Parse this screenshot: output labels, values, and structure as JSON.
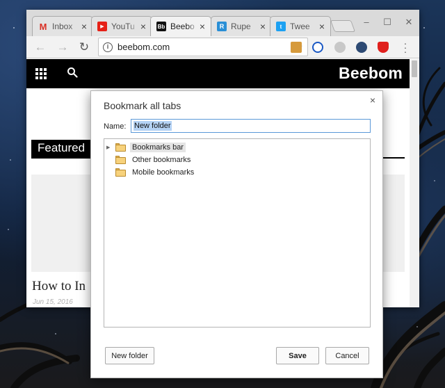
{
  "browser": {
    "tabs": [
      {
        "title": "Inbox",
        "icon": "gmail-icon",
        "active": false
      },
      {
        "title": "YouTu",
        "icon": "youtube-icon",
        "active": false
      },
      {
        "title": "Beebo",
        "icon": "beebom-icon",
        "active": true
      },
      {
        "title": "Rupe",
        "icon": "rupee-icon",
        "active": false
      },
      {
        "title": "Twee",
        "icon": "twitter-icon",
        "active": false
      }
    ],
    "tab_close_glyph": "×",
    "address_bar": {
      "url": "beebom.com",
      "bookmark_starred": true
    },
    "extensions": [
      "cookie-extension-icon",
      "lastpass-icon",
      "ghostery-icon",
      "send-icon",
      "ublock-icon"
    ]
  },
  "site": {
    "brand": "Beebom",
    "featured_label": "Featured",
    "headline": "How to In",
    "date": "Jun 15, 2016"
  },
  "dialog": {
    "title": "Bookmark all tabs",
    "close_glyph": "×",
    "name_label": "Name:",
    "name_value": "New folder",
    "folders": [
      {
        "label": "Bookmarks bar",
        "expandable": true,
        "selected": true
      },
      {
        "label": "Other bookmarks",
        "expandable": false,
        "selected": false
      },
      {
        "label": "Mobile bookmarks",
        "expandable": false,
        "selected": false
      }
    ],
    "new_folder_button": "New folder",
    "save_button": "Save",
    "cancel_button": "Cancel"
  },
  "colors": {
    "accent": "#3b78e7",
    "site_header": "#000000",
    "folder": "#f7d27c",
    "gmail": "#d93025",
    "youtube": "#e62117",
    "rupee": "#2a8fd6",
    "twitter": "#1da1f2"
  }
}
